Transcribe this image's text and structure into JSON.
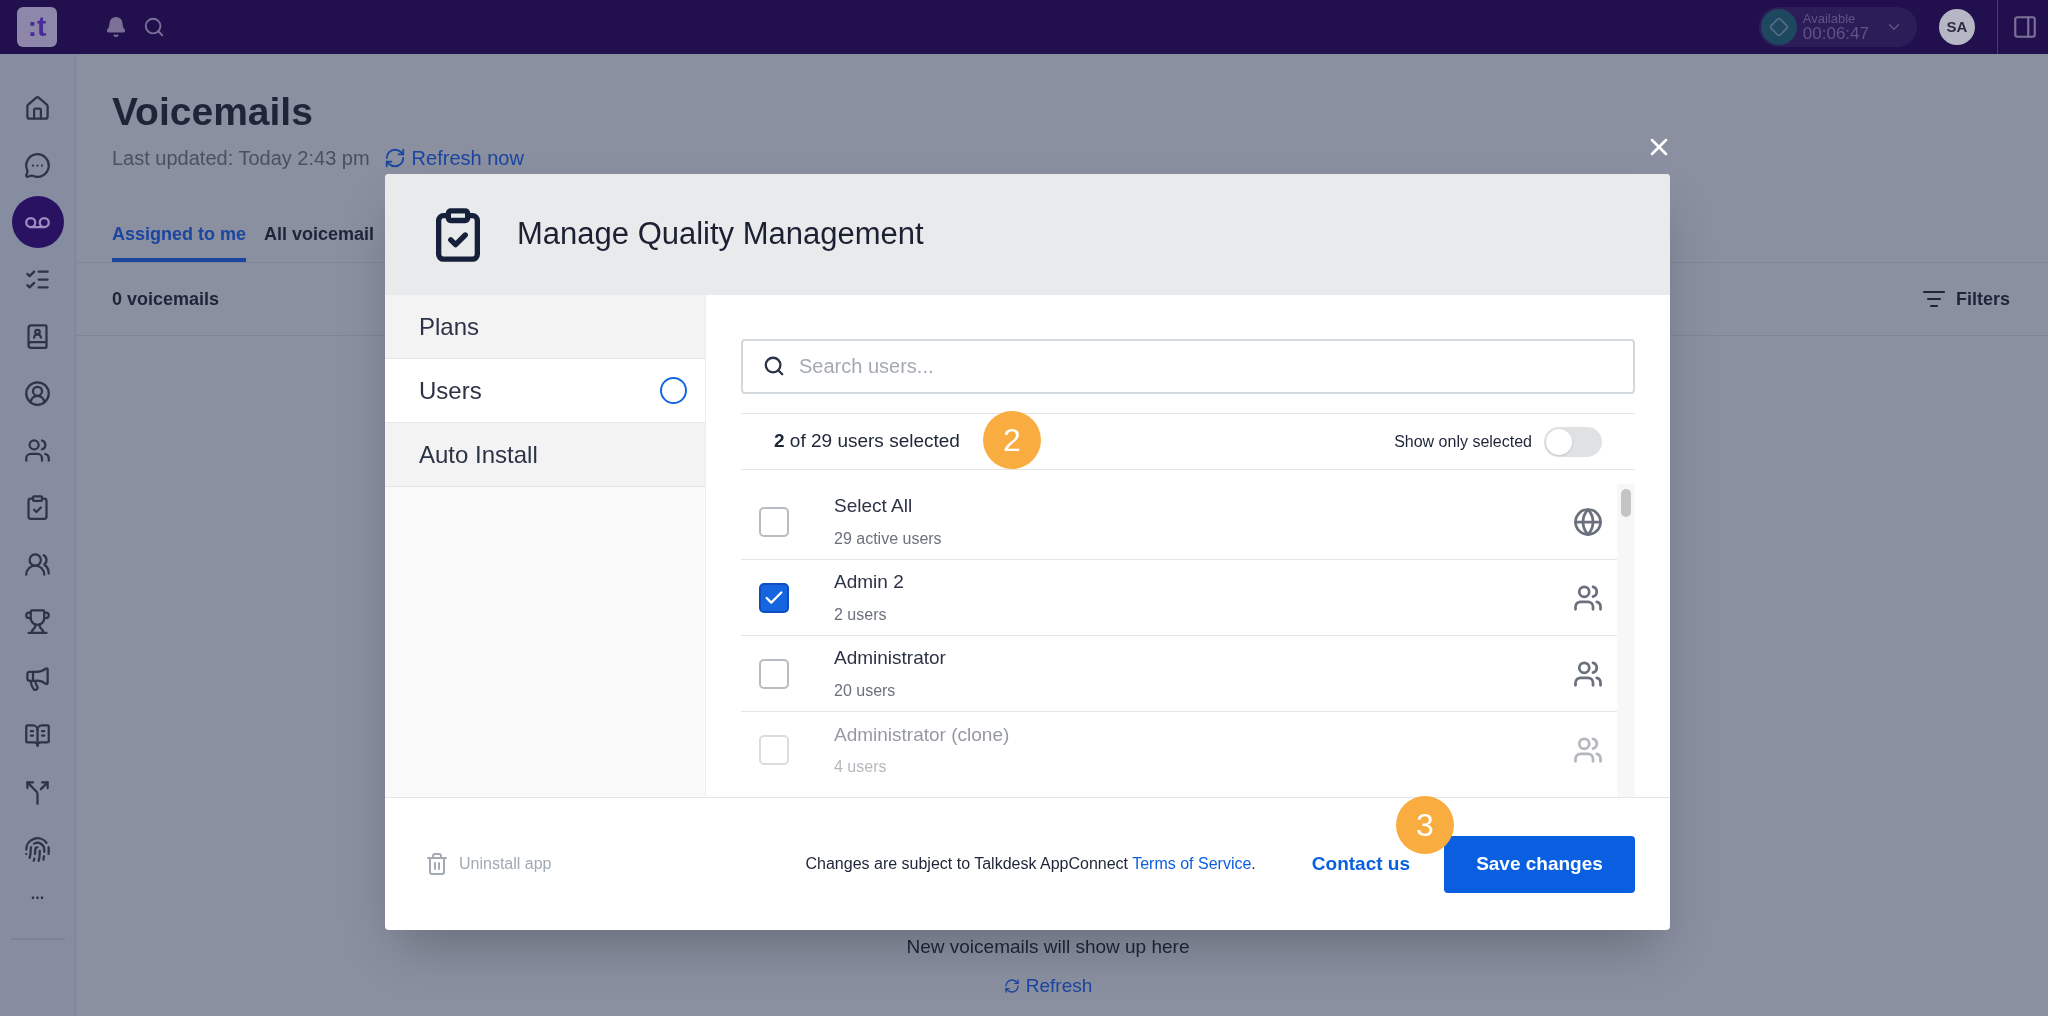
{
  "top_bar": {
    "logo": ":t",
    "status": {
      "label": "Available",
      "timer": "00:06:47"
    },
    "avatar": "SA"
  },
  "nav": [
    {
      "selected": false
    },
    {
      "selected": false
    },
    {
      "selected": true
    },
    {
      "selected": false
    },
    {
      "selected": false
    },
    {
      "selected": false
    },
    {
      "selected": false
    },
    {
      "selected": false
    },
    {
      "selected": false
    },
    {
      "selected": false
    },
    {
      "selected": false
    },
    {
      "selected": false
    },
    {
      "selected": false
    },
    {
      "selected": false
    }
  ],
  "nav_more": "...",
  "page": {
    "title": "Voicemails",
    "last_updated": "Last updated: Today 2:43 pm",
    "refresh_link": "Refresh now",
    "tabs": [
      {
        "label": "Assigned to me",
        "selected": true
      },
      {
        "label": "All voicemail",
        "selected": false
      }
    ],
    "count": "0 voicemails",
    "filters": "Filters",
    "empty_message": "New voicemails will show up here",
    "empty_refresh": "Refresh"
  },
  "modal": {
    "title": "Manage Quality Management",
    "menu": [
      {
        "label": "Plans",
        "selected": false,
        "incomplete": false
      },
      {
        "label": "Users",
        "selected": true,
        "incomplete": true
      },
      {
        "label": "Auto Install",
        "selected": false,
        "incomplete": false
      }
    ],
    "search": {
      "placeholder": "Search users..."
    },
    "selection_count": "**2** of 29 users selected",
    "show_only_selected": {
      "label": "Show only selected",
      "on": false
    },
    "users": [
      {
        "kind": "all",
        "name": "Select All",
        "detail": "29 active users",
        "checked": false
      },
      {
        "kind": "group",
        "name": "Admin 2",
        "detail": "2 users",
        "checked": true
      },
      {
        "kind": "group",
        "name": "Administrator",
        "detail": "20 users",
        "checked": false
      },
      {
        "kind": "group",
        "name": "Administrator (clone)",
        "detail": "4 users",
        "checked": false
      }
    ],
    "footer": {
      "uninstall": "Uninstall app",
      "notice": "Changes are subject to Talkdesk AppConnect",
      "terms_link": "Terms of Service",
      "notice_end": ".",
      "contact": "Contact us",
      "save": "Save changes"
    }
  },
  "callouts": [
    "2",
    "3"
  ]
}
